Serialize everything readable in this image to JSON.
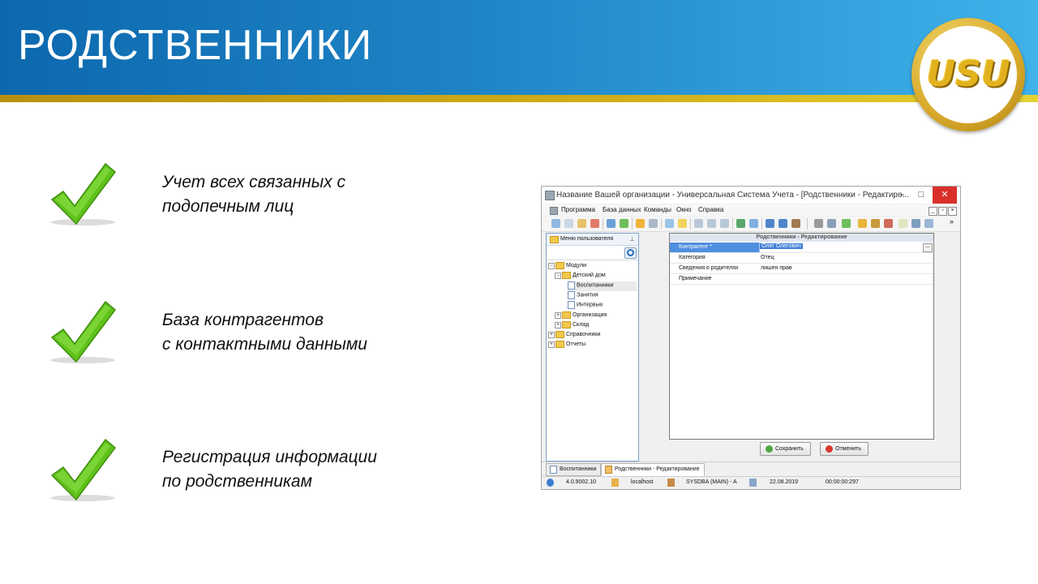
{
  "slide": {
    "title": "РОДСТВЕННИКИ",
    "logo_text": "USU",
    "bullets": [
      {
        "line1": "Учет всех связанных с",
        "line2": "подопечным лиц"
      },
      {
        "line1": "База контрагентов",
        "line2": "с контактными данными"
      },
      {
        "line1": "Регистрация информации",
        "line2": "по родственникам"
      }
    ],
    "colors": {
      "header_start": "#0d68ae",
      "header_end": "#3fb2ea",
      "stripe": "#d1ae1a",
      "check": "#5fc21a"
    }
  },
  "app": {
    "window_title": "Название Вашей организации - Универсальная Система Учета - [Родственники - Редактиро...",
    "title_buttons": {
      "minimize": "–",
      "maximize": "□",
      "close": "✕"
    },
    "menu": [
      "Программа",
      "База данных",
      "Команды",
      "Окно",
      "Справка"
    ],
    "sidebar": {
      "header": "Меню пользователя",
      "tree": [
        {
          "label": "Модули",
          "exp": "−",
          "kind": "folder"
        },
        {
          "label": "Детский дом",
          "exp": "−",
          "kind": "folder"
        },
        {
          "label": "Воспитанники",
          "exp": "",
          "kind": "doc"
        },
        {
          "label": "Занятия",
          "exp": "",
          "kind": "doc"
        },
        {
          "label": "Интервью",
          "exp": "",
          "kind": "doc"
        },
        {
          "label": "Организация",
          "exp": "+",
          "kind": "folder"
        },
        {
          "label": "Склад",
          "exp": "+",
          "kind": "folder"
        },
        {
          "label": "Справочники",
          "exp": "+",
          "kind": "folder"
        },
        {
          "label": "Отчеты",
          "exp": "+",
          "kind": "folder"
        }
      ]
    },
    "edit_panel": {
      "title": "Родственники - Редактирование",
      "fields": [
        {
          "label": "Контрагент *",
          "value": "Олег Олегович"
        },
        {
          "label": "Категория",
          "value": "Отец"
        },
        {
          "label": "Сведения о родителях",
          "value": "лишен прав"
        },
        {
          "label": "Примечание",
          "value": ""
        }
      ],
      "ellipsis": "..."
    },
    "buttons": {
      "save": "Сохранить",
      "cancel": "Отменить"
    },
    "tabs": [
      "Воспитанники",
      "Родственники - Редактирование"
    ],
    "status": {
      "version": "4.0.9002.10",
      "host": "localhost",
      "user": "SYSDBA (MAIN) - A",
      "date": "22.08.2019",
      "timer": "00:00:00:297"
    }
  }
}
